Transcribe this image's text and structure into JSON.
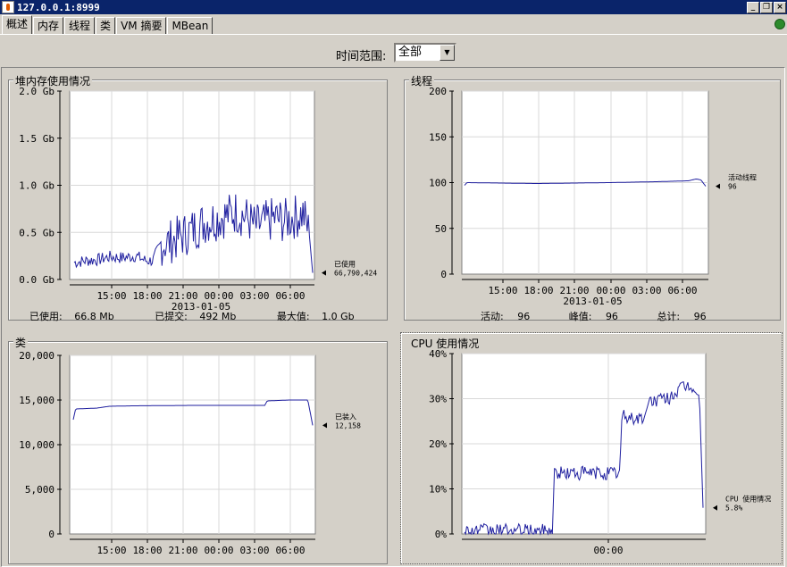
{
  "window": {
    "title": "127.0.0.1:8999",
    "minimize_glyph": "_",
    "restore_glyph": "❐",
    "close_glyph": "×"
  },
  "tabs": [
    "概述",
    "内存",
    "线程",
    "类",
    "VM 摘要",
    "MBean"
  ],
  "time_range": {
    "label": "时间范围:",
    "value": "全部",
    "arrow": "▼"
  },
  "icons": {
    "app": "java-cup-icon",
    "status": "connection-icon"
  },
  "panels": {
    "heap": {
      "title": "堆内存使用情况",
      "footer": {
        "used_label": "已使用:",
        "used": "66.8  Mb",
        "committed_label": "已提交:",
        "committed": "492  Mb",
        "max_label": "最大值:",
        "max": "1.0  Gb"
      }
    },
    "threads": {
      "title": "线程",
      "footer": {
        "live_label": "活动:",
        "live": "96",
        "peak_label": "峰值:",
        "peak": "96",
        "total_label": "总计:",
        "total": "96"
      }
    },
    "classes": {
      "title": "类"
    },
    "cpu": {
      "title": "CPU 使用情况"
    }
  },
  "chart_data": [
    {
      "id": "heap",
      "type": "line",
      "ylim": [
        0,
        2.0
      ],
      "yticks": [
        "0.0 Gb",
        "0.5 Gb",
        "1.0 Gb",
        "1.5 Gb",
        "2.0 Gb"
      ],
      "yvals": [
        0,
        0.5,
        1.0,
        1.5,
        2.0
      ],
      "xticks": [
        "15:00",
        "18:00",
        "21:00",
        "00:00",
        "03:00",
        "06:00"
      ],
      "xdate": "2013-01-05",
      "legend": {
        "label": "已使用",
        "value": "66,790,424"
      },
      "color": "#1f1f9f",
      "profile": [
        [
          0,
          0.18
        ],
        [
          0.05,
          0.2
        ],
        [
          0.1,
          0.21
        ],
        [
          0.15,
          0.24
        ],
        [
          0.2,
          0.23
        ],
        [
          0.26,
          0.25
        ],
        [
          0.3,
          0.2
        ],
        [
          0.33,
          0.2
        ],
        [
          0.36,
          0.37
        ],
        [
          0.4,
          0.4
        ],
        [
          0.44,
          0.45
        ],
        [
          0.48,
          0.5
        ],
        [
          0.52,
          0.57
        ],
        [
          0.56,
          0.62
        ],
        [
          0.6,
          0.65
        ],
        [
          0.64,
          0.68
        ],
        [
          0.68,
          0.72
        ],
        [
          0.72,
          0.66
        ],
        [
          0.76,
          0.56
        ],
        [
          0.8,
          0.6
        ],
        [
          0.84,
          0.65
        ],
        [
          0.88,
          0.62
        ],
        [
          0.92,
          0.66
        ],
        [
          0.96,
          0.7
        ],
        [
          0.985,
          0.5
        ],
        [
          1,
          0.07
        ]
      ],
      "noise": 0.11
    },
    {
      "id": "threads",
      "type": "line",
      "ylim": [
        0,
        200
      ],
      "yticks": [
        "0",
        "50",
        "100",
        "150",
        "200"
      ],
      "yvals": [
        0,
        50,
        100,
        150,
        200
      ],
      "xticks": [
        "15:00",
        "18:00",
        "21:00",
        "00:00",
        "03:00",
        "06:00"
      ],
      "xdate": "2013-01-05",
      "legend": {
        "label": "活动线程",
        "value": "96"
      },
      "color": "#1f1f9f",
      "profile": [
        [
          0,
          97
        ],
        [
          0.01,
          100
        ],
        [
          0.3,
          99
        ],
        [
          0.6,
          100
        ],
        [
          0.8,
          101
        ],
        [
          0.93,
          102
        ],
        [
          0.96,
          104
        ],
        [
          0.98,
          103
        ],
        [
          1,
          96
        ]
      ],
      "noise": 0
    },
    {
      "id": "classes",
      "type": "line",
      "ylim": [
        0,
        20000
      ],
      "yticks": [
        "0",
        "5,000",
        "10,000",
        "15,000",
        "20,000"
      ],
      "yvals": [
        0,
        5000,
        10000,
        15000,
        20000
      ],
      "xticks": [
        "15:00",
        "18:00",
        "21:00",
        "00:00",
        "03:00",
        "06:00"
      ],
      "xdate": "",
      "legend": {
        "label": "已装入",
        "value": "12,158"
      },
      "color": "#1f1f9f",
      "profile": [
        [
          0,
          12800
        ],
        [
          0.01,
          14000
        ],
        [
          0.1,
          14100
        ],
        [
          0.15,
          14300
        ],
        [
          0.25,
          14350
        ],
        [
          0.5,
          14400
        ],
        [
          0.8,
          14400
        ],
        [
          0.81,
          14900
        ],
        [
          0.9,
          15000
        ],
        [
          0.98,
          15000
        ],
        [
          1,
          12158
        ]
      ],
      "noise": 0
    },
    {
      "id": "cpu",
      "type": "line",
      "ylim": [
        0,
        40
      ],
      "yticks": [
        "0%",
        "10%",
        "20%",
        "30%",
        "40%"
      ],
      "yvals": [
        0,
        10,
        20,
        30,
        40
      ],
      "xticks": [
        "00:00"
      ],
      "xdate": "",
      "legend": {
        "label": "CPU 使用情况",
        "value": "5.8%"
      },
      "color": "#1f1f9f",
      "profile": [
        [
          0,
          1.5
        ],
        [
          0.01,
          0.7
        ],
        [
          0.37,
          0.6
        ],
        [
          0.375,
          13.5
        ],
        [
          0.65,
          13.5
        ],
        [
          0.66,
          26
        ],
        [
          0.76,
          25.5
        ],
        [
          0.765,
          29.5
        ],
        [
          0.85,
          30
        ],
        [
          0.9,
          32
        ],
        [
          0.95,
          33
        ],
        [
          0.985,
          30
        ],
        [
          1,
          5.8
        ]
      ],
      "noise": 1.6
    }
  ]
}
